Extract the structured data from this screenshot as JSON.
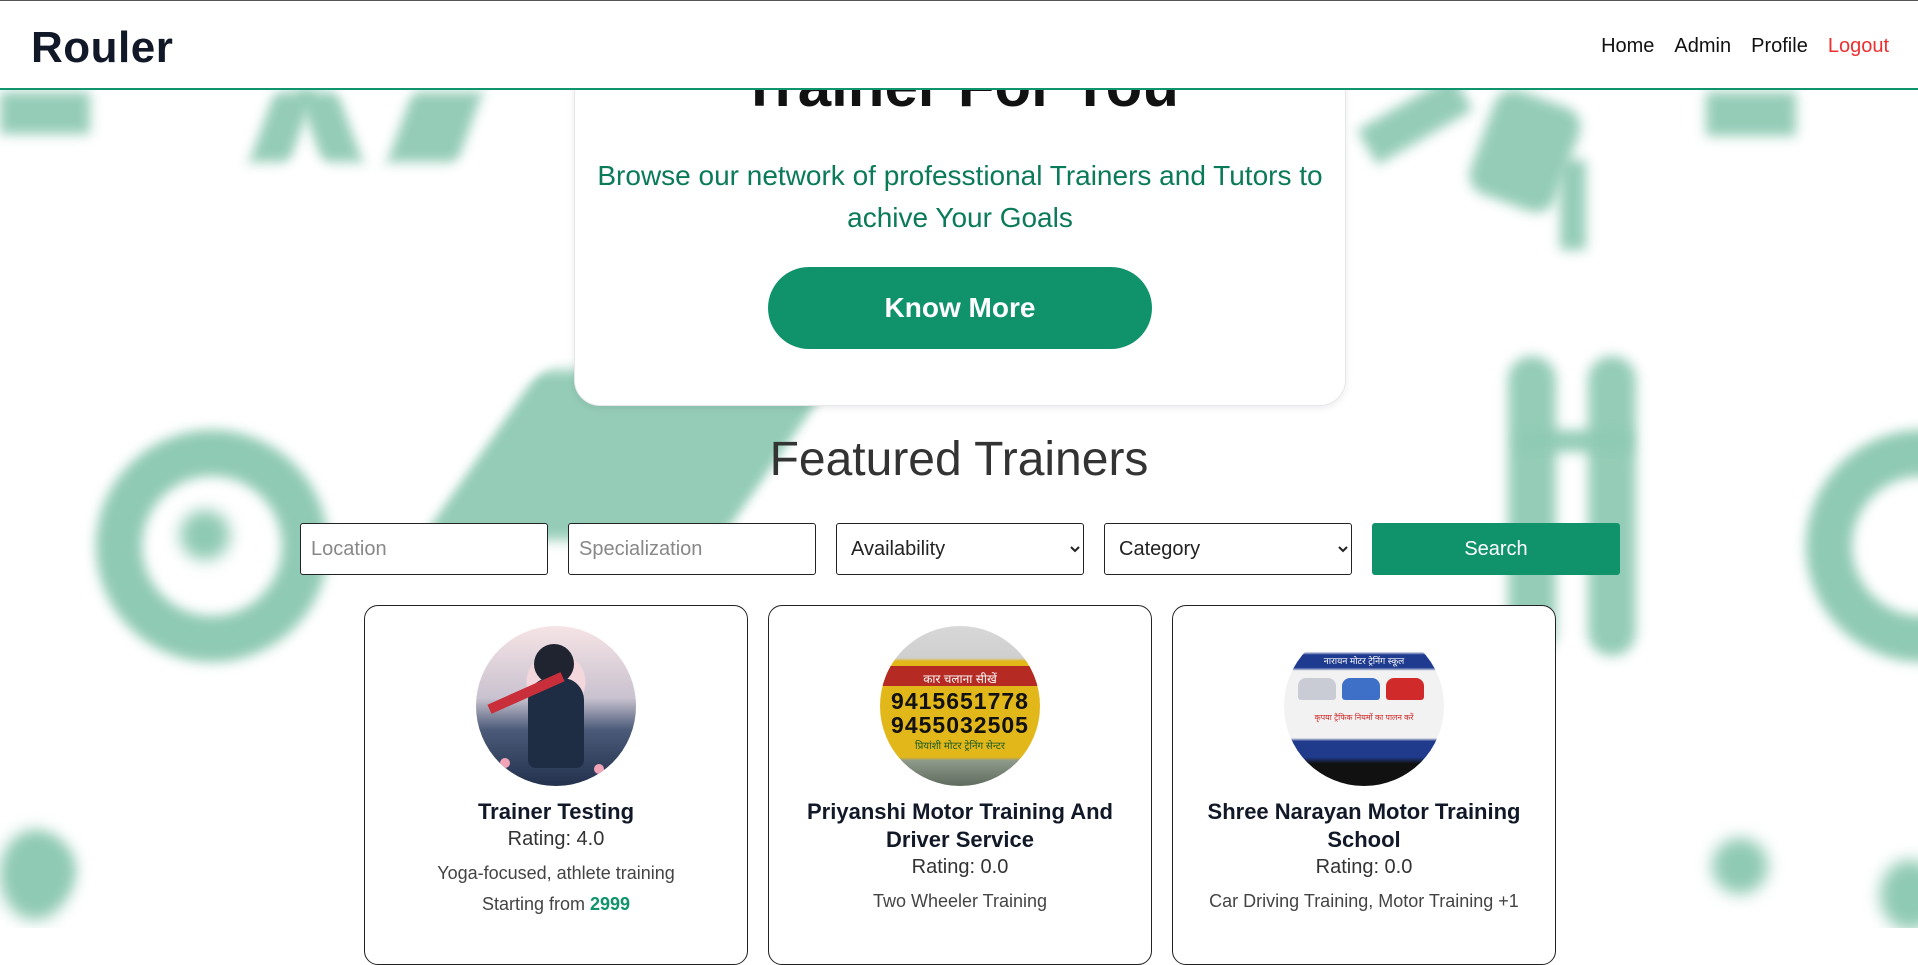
{
  "navbar": {
    "brand": "Rouler",
    "links": [
      "Home",
      "Admin",
      "Profile",
      "Logout"
    ]
  },
  "hero": {
    "title": "Trainer For You",
    "subtitle": "Browse our network of professtional Trainers and Tutors to achive Your Goals",
    "button": "Know More"
  },
  "featured": {
    "title": "Featured Trainers"
  },
  "filters": {
    "location_placeholder": "Location",
    "specialization_placeholder": "Specialization",
    "availability": "Availability",
    "category": "Category",
    "search_label": "Search"
  },
  "trainers": [
    {
      "name": "Trainer Testing",
      "rating": "Rating: 4.0",
      "spec": "Yoga-focused, athlete training",
      "price_prefix": "Starting from ",
      "price": "2999"
    },
    {
      "name": "Priyanshi Motor Training And Driver Service",
      "rating": "Rating: 0.0",
      "spec": "Two Wheeler Training",
      "sign_line1": "कार चलाना सीखें",
      "sign_line2": "9415651778",
      "sign_line3": "9455032505",
      "sign_line4": "प्रियांशी मोटर ट्रेनिंग सेन्टर"
    },
    {
      "name": "Shree Narayan Motor Training School",
      "rating": "Rating: 0.0",
      "spec": "Car Driving Training, Motor Training +1",
      "sign_line1": "नारायन मोटर ट्रेनिंग स्कूल",
      "sign_line2": "कृपया ट्रैफिक नियमों का पालन करें"
    }
  ],
  "colors": {
    "accent": "#10936b",
    "logout": "#ef2f2f",
    "background_pattern": "#8fcab4"
  }
}
